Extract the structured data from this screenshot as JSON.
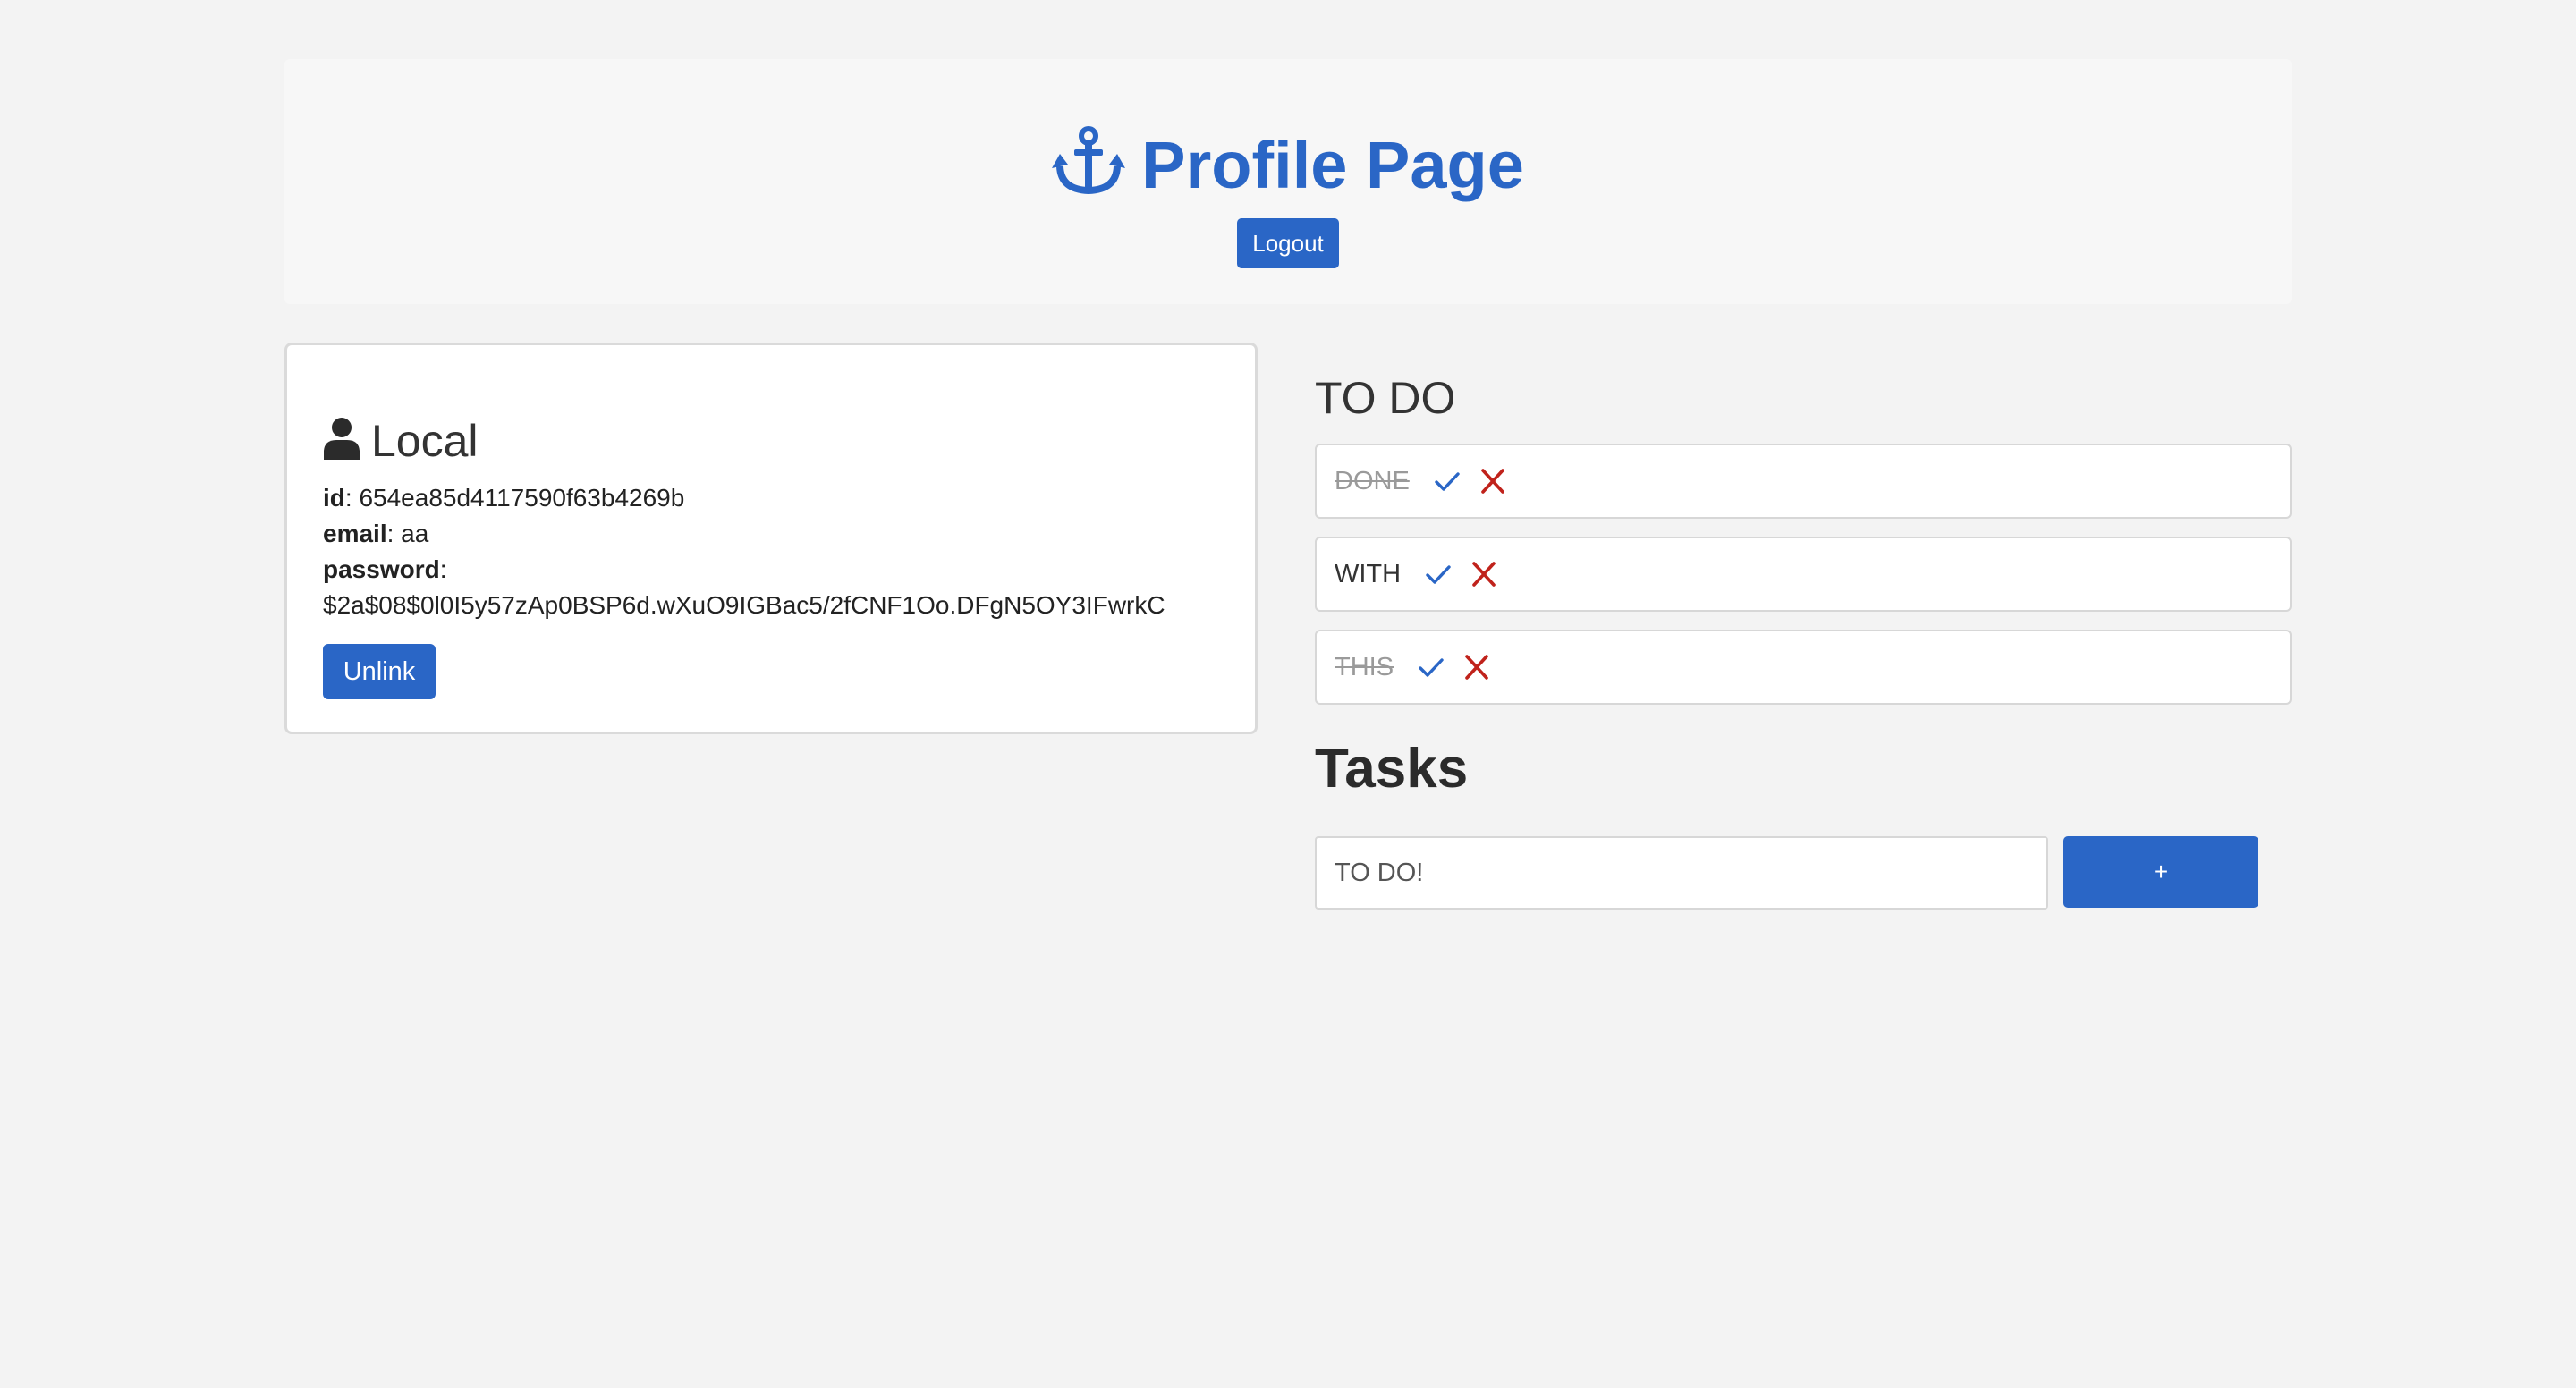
{
  "header": {
    "title": "Profile Page",
    "logout_label": "Logout"
  },
  "local_card": {
    "heading": "Local",
    "fields": [
      {
        "label": "id",
        "value": "654ea85d4117590f63b4269b"
      },
      {
        "label": "email",
        "value": "aa"
      },
      {
        "label": "password",
        "value": "$2a$08$0l0I5y57zAp0BSP6d.wXuO9IGBac5/2fCNF1Oo.DFgN5OY3IFwrkC"
      }
    ],
    "unlink_label": "Unlink"
  },
  "todo": {
    "heading": "TO DO",
    "items": [
      {
        "text": "DONE",
        "done": true
      },
      {
        "text": "WITH",
        "done": false
      },
      {
        "text": "THIS",
        "done": true
      }
    ]
  },
  "tasks": {
    "heading": "Tasks",
    "input_value": "TO DO!",
    "input_placeholder": "",
    "add_label": "+"
  },
  "colors": {
    "accent": "#2a66c6",
    "delete": "#c0221b",
    "background": "#f3f3f3"
  }
}
